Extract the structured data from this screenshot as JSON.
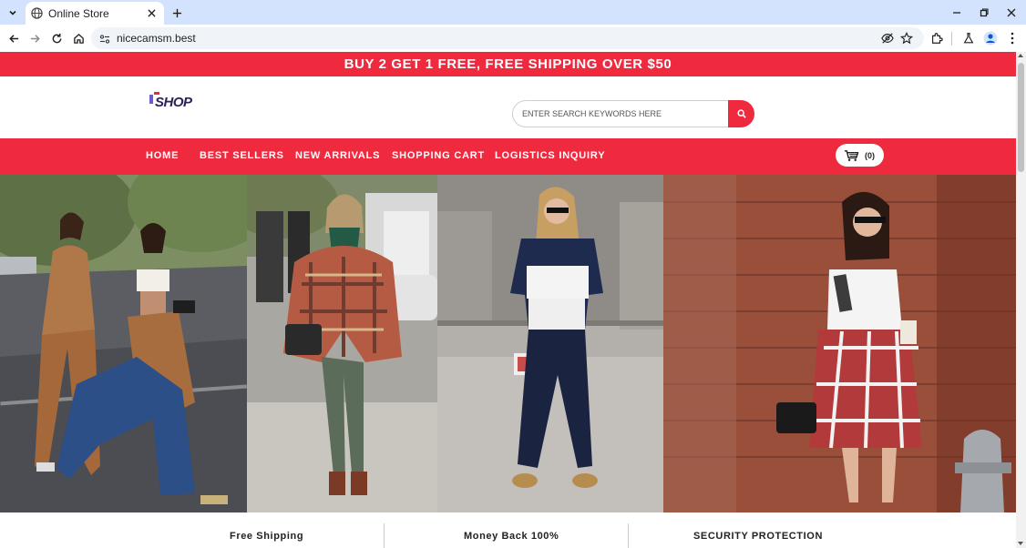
{
  "browser": {
    "tab_title": "Online Store",
    "url": "nicecamsm.best"
  },
  "promo_text": "BUY 2 GET 1 FREE, FREE SHIPPING OVER $50",
  "logo": {
    "text": "SHOP"
  },
  "search": {
    "placeholder": "ENTER SEARCH KEYWORDS HERE"
  },
  "nav": {
    "items": [
      {
        "label": "HOME"
      },
      {
        "label": "BEST SELLERS"
      },
      {
        "label": "NEW ARRIVALS"
      },
      {
        "label": "SHOPPING CART"
      },
      {
        "label": "LOGISTICS INQUIRY"
      }
    ],
    "cart_count": "(0)"
  },
  "features": [
    {
      "label": "Free Shipping"
    },
    {
      "label": "Money Back 100%"
    },
    {
      "label": "SECURITY PROTECTION"
    }
  ],
  "colors": {
    "brand_red": "#ef2a3f",
    "chrome_blue": "#d3e3fd"
  }
}
